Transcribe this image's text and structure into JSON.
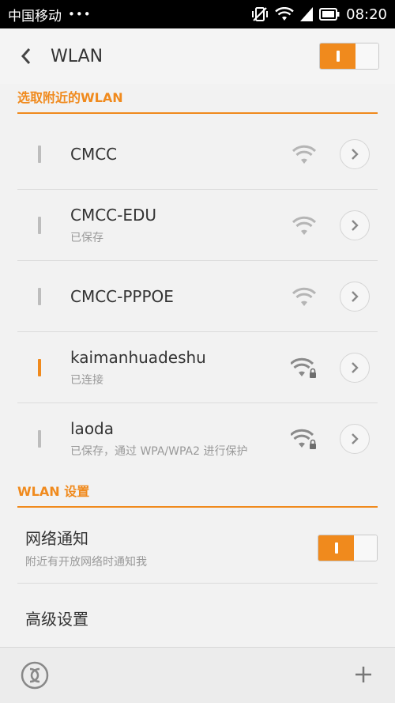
{
  "status_bar": {
    "carrier": "中国移动",
    "dots": "•••",
    "time": "08:20"
  },
  "header": {
    "title": "WLAN",
    "wlan_enabled": true
  },
  "sections": {
    "nearby": "选取附近的WLAN",
    "settings": "WLAN 设置"
  },
  "networks": [
    {
      "name": "CMCC",
      "subtitle": "",
      "connected": false,
      "secured": false
    },
    {
      "name": "CMCC-EDU",
      "subtitle": "已保存",
      "connected": false,
      "secured": false
    },
    {
      "name": "CMCC-PPPOE",
      "subtitle": "",
      "connected": false,
      "secured": false
    },
    {
      "name": "kaimanhuadeshu",
      "subtitle": "已连接",
      "connected": true,
      "secured": true
    },
    {
      "name": "laoda",
      "subtitle": "已保存，通过 WPA/WPA2 进行保护",
      "connected": false,
      "secured": true
    }
  ],
  "settings": {
    "notify_title": "网络通知",
    "notify_subtitle": "附近有开放网络时通知我",
    "notify_enabled": true,
    "advanced_title": "高级设置"
  },
  "colors": {
    "accent": "#f08a1d",
    "status_bar": "#000000",
    "background": "#f2f2f2"
  }
}
